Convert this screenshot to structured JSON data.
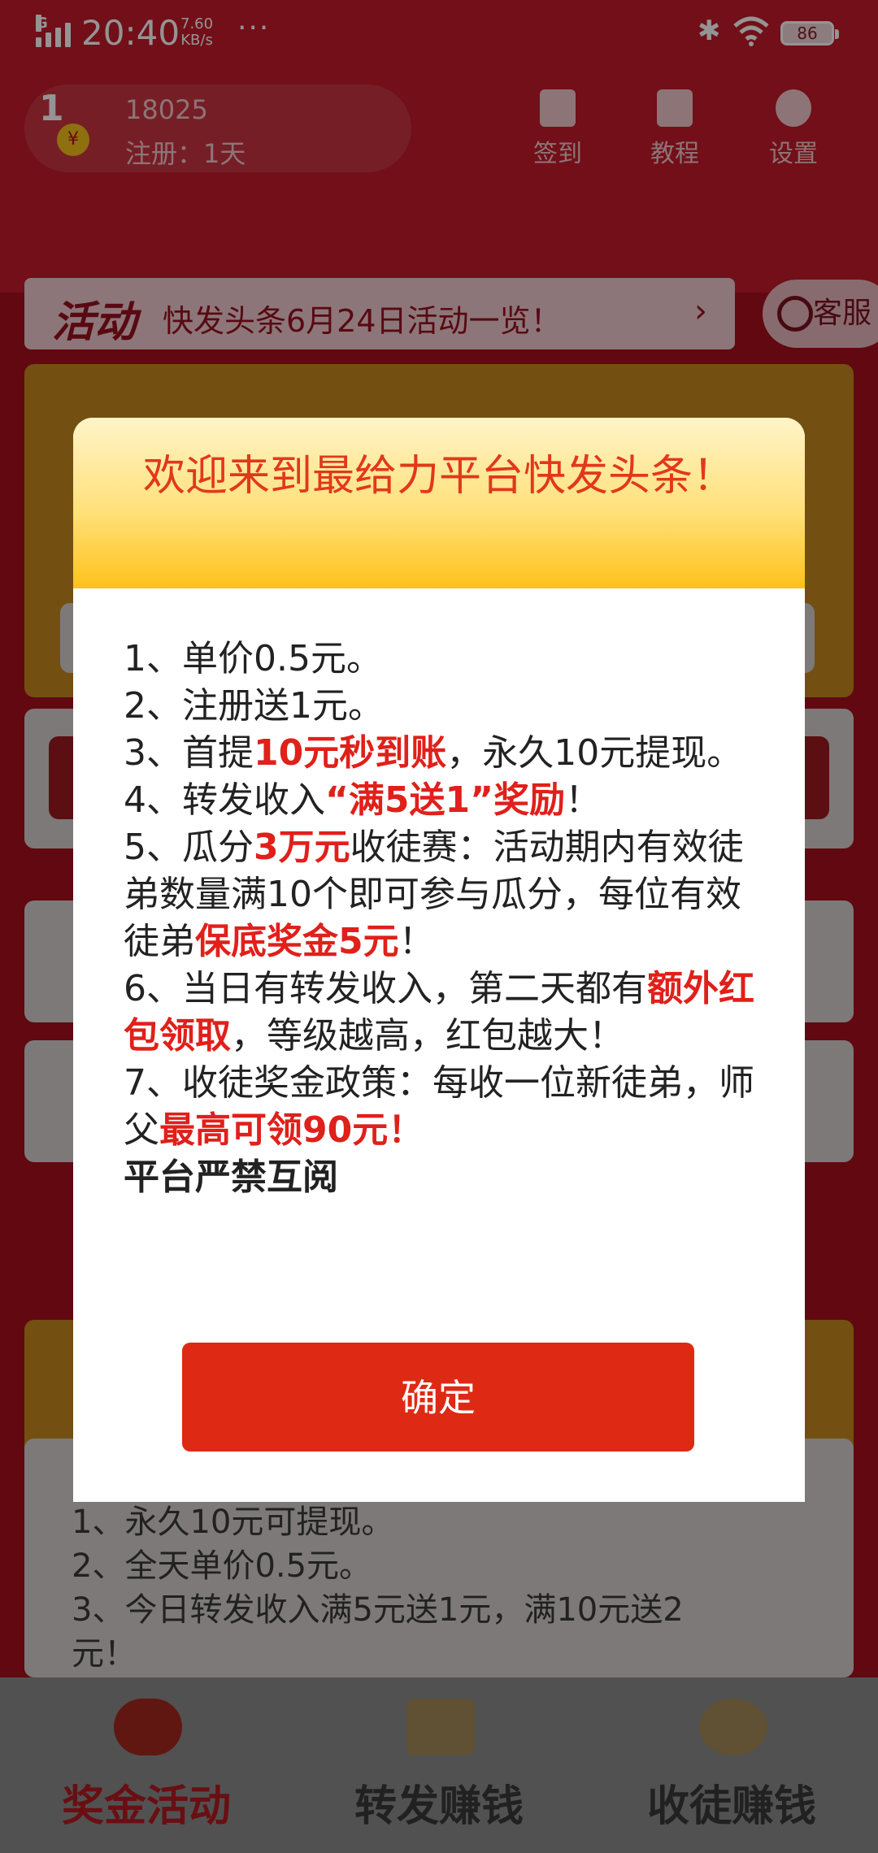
{
  "status_bar": {
    "network": "G",
    "time": "20:40",
    "speed_value": "7.60",
    "speed_unit": "KB/s",
    "more": "···",
    "bluetooth": "✱",
    "battery": "86"
  },
  "user": {
    "level": "1",
    "coin_symbol": "¥",
    "id": "18025",
    "registered": "注册：1天"
  },
  "top_actions": [
    {
      "label": "签到",
      "icon": "envelope-icon"
    },
    {
      "label": "教程",
      "icon": "book-icon"
    },
    {
      "label": "设置",
      "icon": "gear-icon"
    }
  ],
  "banner": {
    "tag": "活动",
    "text": "快发头条6月24日活动一览！",
    "arrow": "›"
  },
  "kefu": {
    "label": "客服"
  },
  "background_rules": [
    "1、永久10元可提现。",
    "2、全天单价0.5元。",
    "3、今日转发收入满5元送1元，满10元送2",
    "元！"
  ],
  "bottom_nav": [
    {
      "label": "奖金活动",
      "icon": "money-bag-icon",
      "color": "#b51a22"
    },
    {
      "label": "转发赚钱",
      "icon": "share-arrow-icon",
      "color": "#3a3a3a"
    },
    {
      "label": "收徒赚钱",
      "icon": "coin-icon",
      "color": "#3a3a3a"
    }
  ],
  "modal": {
    "title": "欢迎来到最给力平台快发头条！",
    "items": {
      "i1": "1、单价0.5元。",
      "i2": "2、注册送1元。",
      "i3a": "3、首提",
      "i3b": "10元秒到账",
      "i3c": "，永久10元提现。",
      "i4a": "4、转发收入",
      "i4b": "“满5送1”奖励",
      "i4c": "！",
      "i5a": "5、瓜分",
      "i5b": "3万元",
      "i5c": "收徒赛：活动期内有效徒弟数量满10个即可参与瓜分，每位有效徒弟",
      "i5d": "保底奖金5元",
      "i5e": "！",
      "i6a": "6、当日有转发收入，第二天都有",
      "i6b": "额外红包领取",
      "i6c": "，等级越高，红包越大！",
      "i7a": "7、收徒奖金政策：每收一位新徒弟，师父",
      "i7b": "最高可领90元！",
      "i8": "平台严禁互阅"
    },
    "confirm": "确定"
  },
  "colors": {
    "primary_red": "#de2a14",
    "highlight_red": "#e0201a",
    "title_red": "#e2381a",
    "header_gold": "#ffc21a"
  }
}
